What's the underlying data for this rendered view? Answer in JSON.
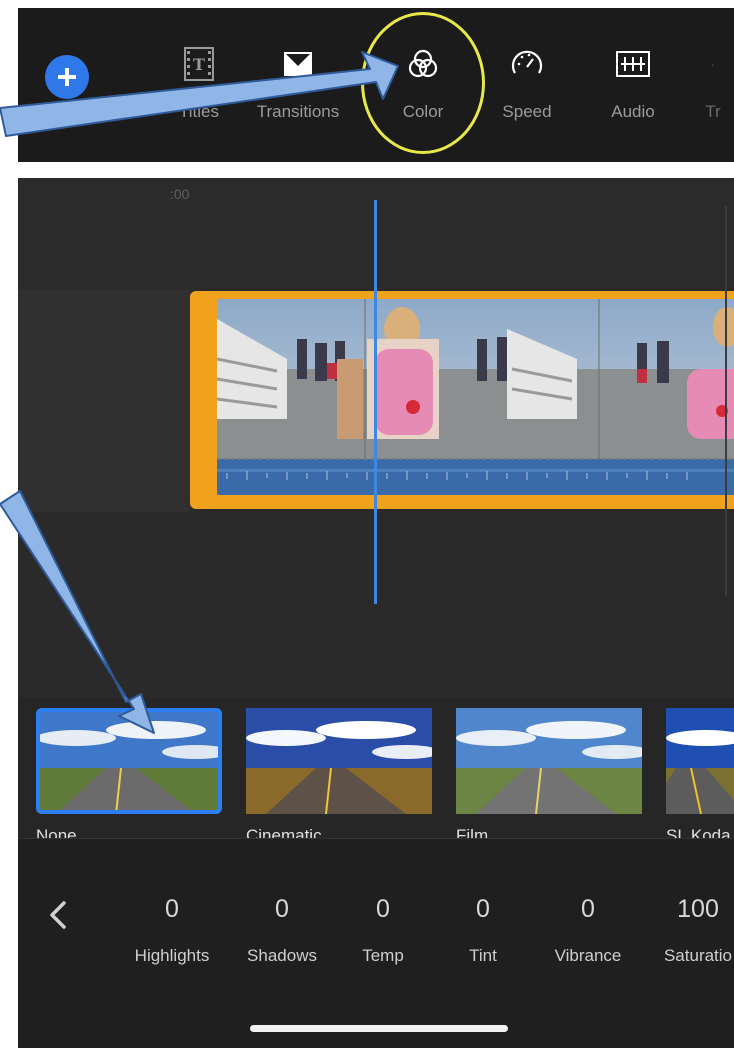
{
  "toolbar": {
    "items": [
      {
        "label": "Titles",
        "icon": "titles-icon"
      },
      {
        "label": "Transitions",
        "icon": "transitions-icon"
      },
      {
        "label": "Color",
        "icon": "color-icon"
      },
      {
        "label": "Speed",
        "icon": "speed-icon"
      },
      {
        "label": "Audio",
        "icon": "audio-icon"
      },
      {
        "label": "Tr",
        "icon": "trim-icon"
      }
    ],
    "add_icon": "plus-icon"
  },
  "timeline": {
    "timecode": ":00"
  },
  "filters": [
    {
      "name": "None",
      "selected": true
    },
    {
      "name": "Cinematic",
      "selected": false
    },
    {
      "name": "Film",
      "selected": false
    },
    {
      "name": "SL Koda",
      "selected": false
    }
  ],
  "adjustments": [
    {
      "label": "Highlights",
      "value": "0"
    },
    {
      "label": "Shadows",
      "value": "0"
    },
    {
      "label": "Temp",
      "value": "0"
    },
    {
      "label": "Tint",
      "value": "0"
    },
    {
      "label": "Vibrance",
      "value": "0"
    },
    {
      "label": "Saturatio",
      "value": "100"
    }
  ],
  "colors": {
    "accent": "#2f78e9",
    "highlight_ring": "#e8e84a",
    "clip_border": "#f1a21d",
    "playhead": "#3d88e3",
    "annotation_arrow": "#8fb6e6"
  }
}
